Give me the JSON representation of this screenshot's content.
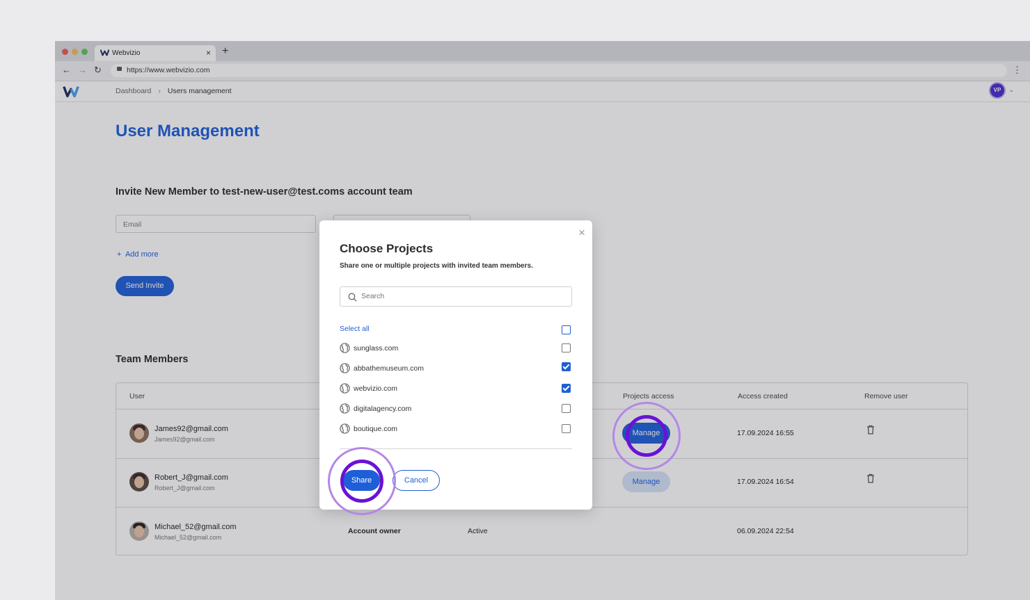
{
  "browser": {
    "tab_title": "Webvizio",
    "tab_close": "×",
    "new_tab": "+",
    "url": "https://www.webvizio.com",
    "traffic_colors": [
      "#ee5d55",
      "#f5bd4f",
      "#5fc454"
    ]
  },
  "header": {
    "breadcrumb": [
      "Dashboard",
      "Users management"
    ],
    "breadcrumb_sep": "›",
    "avatar_initials": "VP"
  },
  "page": {
    "title": "User Management",
    "invite_title": "Invite New Member to test-new-user@test.coms account team",
    "email_placeholder": "Email",
    "add_more": "Add more",
    "send_invite": "Send Invite",
    "team_title": "Team Members"
  },
  "table": {
    "headers": {
      "user": "User",
      "projects_access": "Projects access",
      "access_created": "Access created",
      "remove_user": "Remove user"
    },
    "rows": [
      {
        "name": "James92@gmail.com",
        "email": "James92@gmail.com",
        "manage": "Manage",
        "created": "17.09.2024 16:55"
      },
      {
        "name": "Robert_J@gmail.com",
        "email": "Robert_J@gmail.com",
        "manage": "Manage",
        "created": "17.09.2024 16:54"
      },
      {
        "name": "Michael_52@gmail.com",
        "email": "Michael_52@gmail.com",
        "role": "Account owner",
        "status": "Active",
        "created": "06.09.2024 22:54"
      }
    ]
  },
  "modal": {
    "title": "Choose Projects",
    "subtitle": "Share one or multiple projects with invited team members.",
    "search_placeholder": "Search",
    "select_all": "Select all",
    "projects": [
      {
        "name": "sunglass.com",
        "checked": false
      },
      {
        "name": "abbathemuseum.com",
        "checked": true
      },
      {
        "name": "webvizio.com",
        "checked": true
      },
      {
        "name": "digitalagency.com",
        "checked": false
      },
      {
        "name": "boutique.com",
        "checked": false
      }
    ],
    "share": "Share",
    "cancel": "Cancel",
    "close": "×"
  },
  "colors": {
    "accent": "#1e5fd8",
    "highlight_ring": "#6a12d6"
  }
}
